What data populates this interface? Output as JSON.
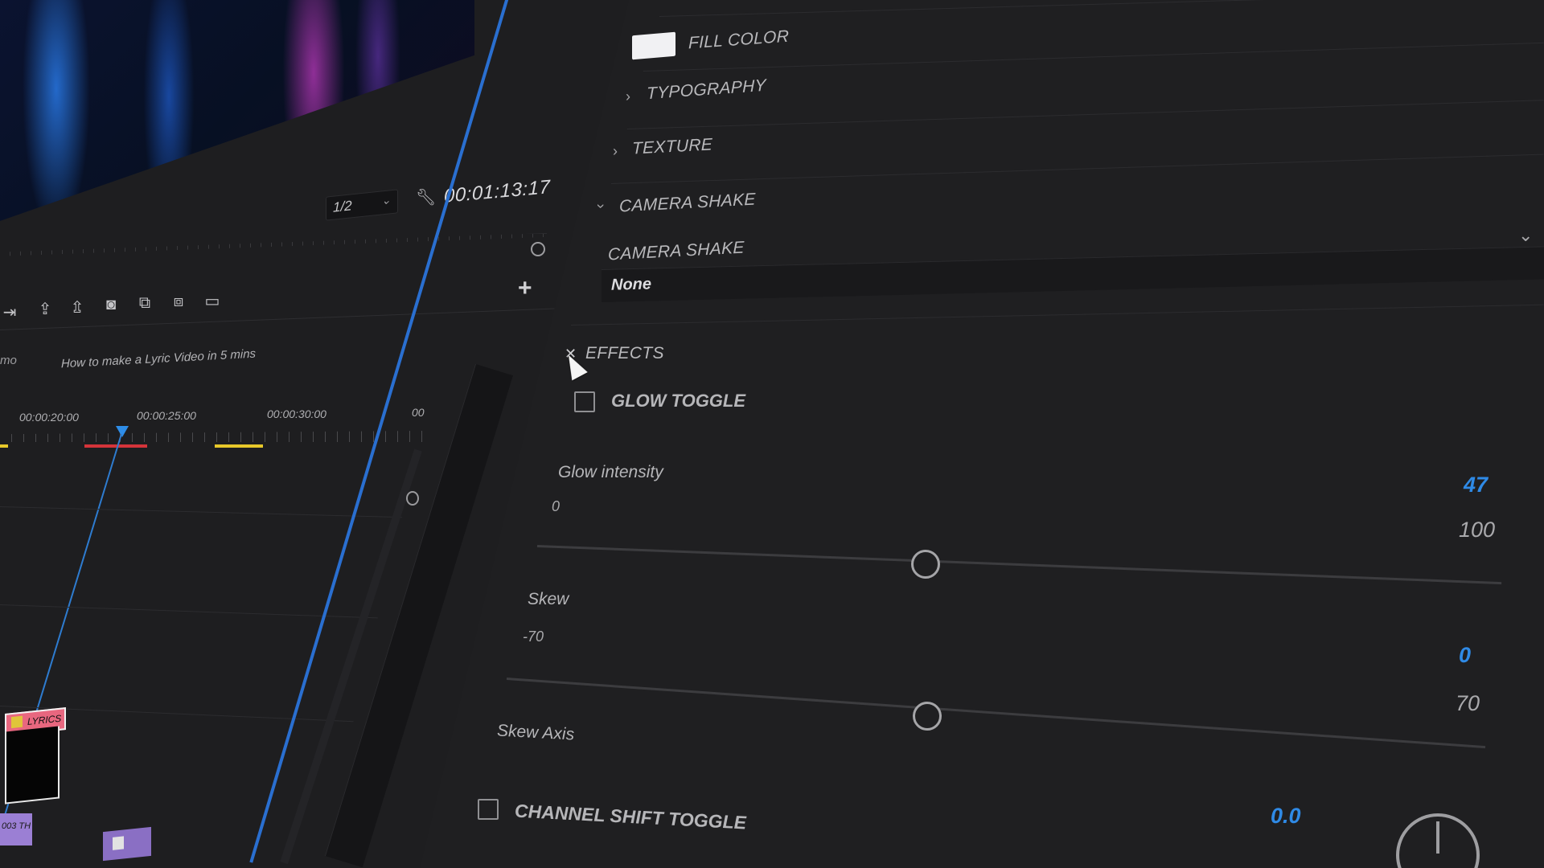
{
  "monitor": {
    "zoom": "1/2",
    "timecode": "00:01:13:17"
  },
  "timeline": {
    "sequence_tab_partial": "mo",
    "sequence_title": "How to make a Lyric Video in 5 mins",
    "ruler_labels": [
      "00:00:20:00",
      "00:00:25:00",
      "00:00:30:00",
      "00"
    ],
    "clip_title_label": "LYRICS",
    "clip_purple_label": "003 TH"
  },
  "panel": {
    "fill_color_label": "FILL COLOR",
    "fill_color_value": "#f1f1f3",
    "sections": {
      "typography": "TYPOGRAPHY",
      "texture": "TEXTURE",
      "camera_shake": "CAMERA SHAKE",
      "effects": "EFFECTS"
    },
    "camera_shake_dropdown": {
      "label": "CAMERA SHAKE",
      "value": "None"
    },
    "glow_toggle": {
      "label": "GLOW TOGGLE",
      "checked": false
    },
    "glow_intensity": {
      "label": "Glow intensity",
      "min": "0",
      "max": "100",
      "value": "47"
    },
    "skew": {
      "label": "Skew",
      "min": "-70",
      "max": "70",
      "value": "0"
    },
    "skew_axis": {
      "label": "Skew Axis"
    },
    "channel_shift_toggle": {
      "label": "CHANNEL SHIFT TOGGLE",
      "value": "0.0",
      "checked": false
    }
  },
  "colors": {
    "accent_blue": "#2f8ae6",
    "seam_blue": "#2a6fd0",
    "range_red": "#d4343a",
    "range_yellow": "#e7c82a"
  }
}
